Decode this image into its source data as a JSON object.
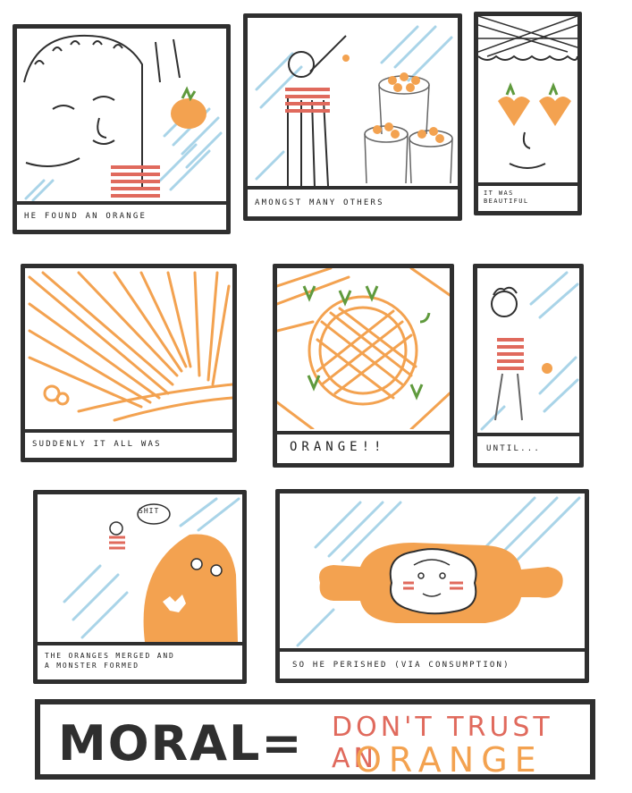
{
  "panels": {
    "p1": {
      "caption": "HE FOUND AN ORANGE"
    },
    "p2": {
      "caption": "AMONGST MANY OTHERS"
    },
    "p3": {
      "caption": "IT WAS\nBEAUTIFUL"
    },
    "p4": {
      "caption": "SUDDENLY     IT ALL WAS"
    },
    "p5": {
      "caption": "ORANGE!!"
    },
    "p6": {
      "caption": "UNTIL..."
    },
    "p7": {
      "caption": "THE ORANGES MERGED AND\nA MONSTER FORMED",
      "speech": "SHIT"
    },
    "p8": {
      "caption": "SO HE PERISHED  (VIA CONSUMPTION)"
    }
  },
  "moral": {
    "word": "MORAL=",
    "line1": "DON'T TRUST AN",
    "line2": "ORANGE"
  },
  "colors": {
    "ink": "#2f2f2f",
    "orange": "#f3a250",
    "coral": "#e06a5d",
    "sky": "#a9d4e8",
    "leaf": "#5f9a3d"
  }
}
